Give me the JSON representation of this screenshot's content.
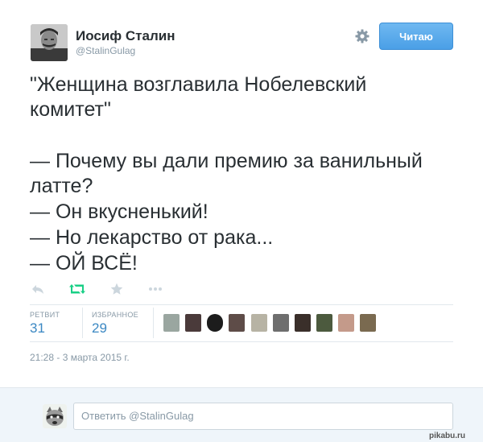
{
  "author": {
    "name": "Иосиф Сталин",
    "handle": "@StalinGulag"
  },
  "follow_button": {
    "label": "Читаю"
  },
  "tweet_lines": [
    "\"Женщина возглавила Нобелевский",
    "комитет\"",
    "— Почему вы дали премию за ванильный",
    "латте?",
    "— Он вкусненький!",
    "— Но лекарство от рака...",
    "— ОЙ ВСЁ!"
  ],
  "actions": {
    "reply_icon": "reply-icon",
    "retweet_icon": "retweet-icon",
    "favorite_icon": "star-icon",
    "more_icon": "more-icon",
    "retweet_color": "#19cf86"
  },
  "stats": {
    "retweets_label": "РЕТВИТ",
    "retweets_value": "31",
    "favorites_label": "ИЗБРАННОЕ",
    "favorites_value": "29"
  },
  "favoriter_count": 10,
  "timestamp": "21:28 - 3 марта 2015 г.",
  "reply": {
    "placeholder": "Ответить @StalinGulag"
  },
  "watermark": "pikabu.ru",
  "colors": {
    "link": "#3b88c3",
    "follow_button": "#4a9fe6",
    "muted": "#8899a6",
    "text": "#292f33"
  }
}
